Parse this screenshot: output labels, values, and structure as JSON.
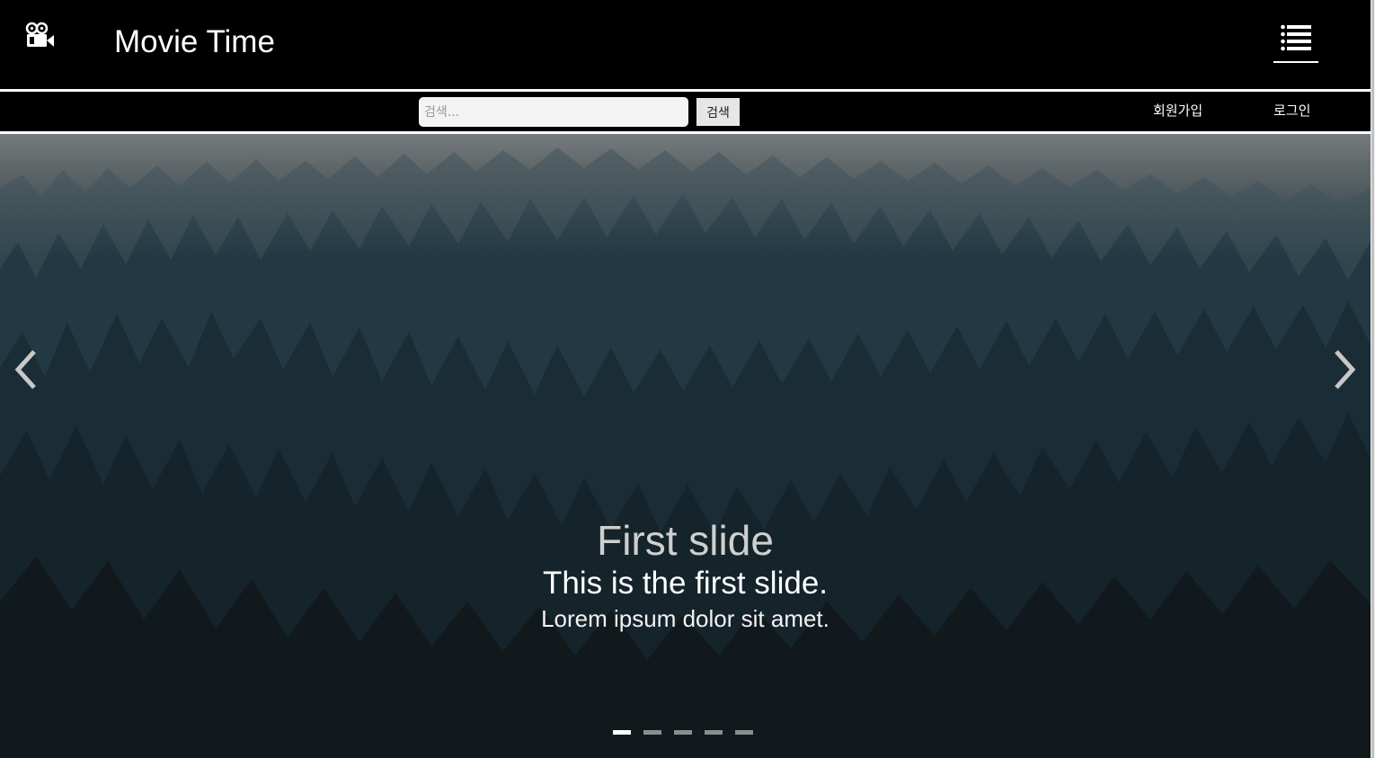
{
  "header": {
    "brand": "Movie Time",
    "logo_icon": "movie-camera-icon",
    "menu_icon": "list-menu-icon"
  },
  "subnav": {
    "search_placeholder": "검색...",
    "search_value": "",
    "search_button": "검색",
    "signup_label": "회원가입",
    "login_label": "로그인"
  },
  "carousel": {
    "title": "First slide",
    "subtitle": "This is the first slide.",
    "body": "Lorem ipsum dolor sit amet.",
    "slide_count": 5,
    "active_index": 0,
    "prev_icon": "chevron-left-icon",
    "next_icon": "chevron-right-icon"
  },
  "colors": {
    "header_bg": "#000000",
    "divider": "#ffffff",
    "indicator_active": "#ffffff",
    "indicator_inactive": "#8a8e90"
  }
}
